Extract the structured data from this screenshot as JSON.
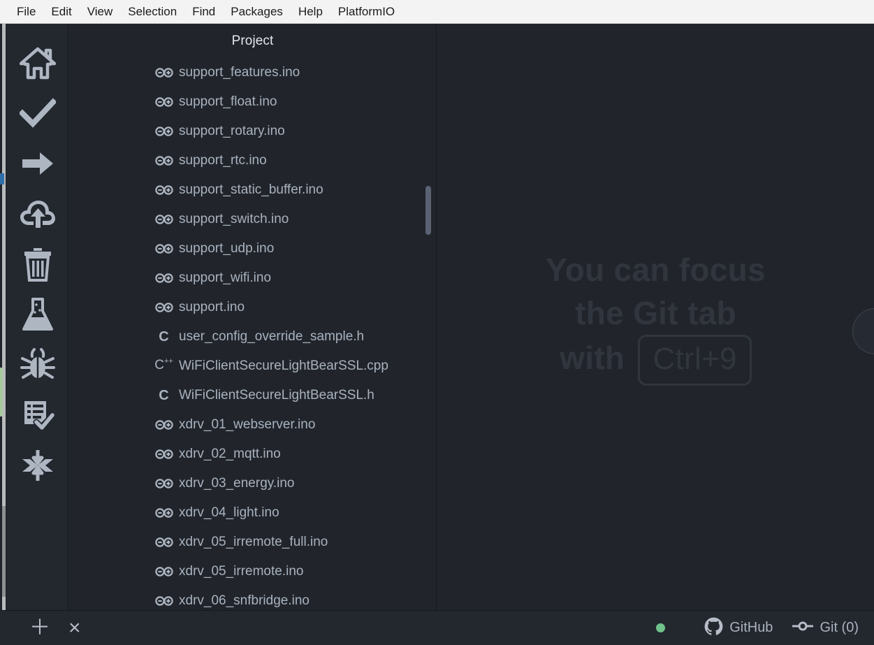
{
  "menubar": {
    "items": [
      {
        "label": "File",
        "name": "menu-file"
      },
      {
        "label": "Edit",
        "name": "menu-edit"
      },
      {
        "label": "View",
        "name": "menu-view"
      },
      {
        "label": "Selection",
        "name": "menu-selection"
      },
      {
        "label": "Find",
        "name": "menu-find"
      },
      {
        "label": "Packages",
        "name": "menu-packages"
      },
      {
        "label": "Help",
        "name": "menu-help"
      },
      {
        "label": "PlatformIO",
        "name": "menu-platformio"
      }
    ]
  },
  "dock": {
    "items": [
      {
        "icon": "home-icon",
        "name": "dock-home"
      },
      {
        "icon": "check-icon",
        "name": "dock-build"
      },
      {
        "icon": "arrow-right-icon",
        "name": "dock-run"
      },
      {
        "icon": "cloud-upload-icon",
        "name": "dock-upload"
      },
      {
        "icon": "trash-icon",
        "name": "dock-clean"
      },
      {
        "icon": "flask-icon",
        "name": "dock-test"
      },
      {
        "icon": "bug-icon",
        "name": "dock-debug"
      },
      {
        "icon": "clipboard-check-icon",
        "name": "dock-report"
      },
      {
        "icon": "collapse-arrows-icon",
        "name": "dock-collapse"
      }
    ]
  },
  "tree": {
    "title": "Project",
    "files": [
      {
        "label": "support_features.ino",
        "icon": "arduino-icon"
      },
      {
        "label": "support_float.ino",
        "icon": "arduino-icon"
      },
      {
        "label": "support_rotary.ino",
        "icon": "arduino-icon"
      },
      {
        "label": "support_rtc.ino",
        "icon": "arduino-icon"
      },
      {
        "label": "support_static_buffer.ino",
        "icon": "arduino-icon"
      },
      {
        "label": "support_switch.ino",
        "icon": "arduino-icon"
      },
      {
        "label": "support_udp.ino",
        "icon": "arduino-icon"
      },
      {
        "label": "support_wifi.ino",
        "icon": "arduino-icon"
      },
      {
        "label": "support.ino",
        "icon": "arduino-icon"
      },
      {
        "label": "user_config_override_sample.h",
        "icon": "c-header-icon"
      },
      {
        "label": "WiFiClientSecureLightBearSSL.cpp",
        "icon": "cpp-icon"
      },
      {
        "label": "WiFiClientSecureLightBearSSL.h",
        "icon": "c-header-icon"
      },
      {
        "label": "xdrv_01_webserver.ino",
        "icon": "arduino-icon"
      },
      {
        "label": "xdrv_02_mqtt.ino",
        "icon": "arduino-icon"
      },
      {
        "label": "xdrv_03_energy.ino",
        "icon": "arduino-icon"
      },
      {
        "label": "xdrv_04_light.ino",
        "icon": "arduino-icon"
      },
      {
        "label": "xdrv_05_irremote_full.ino",
        "icon": "arduino-icon"
      },
      {
        "label": "xdrv_05_irremote.ino",
        "icon": "arduino-icon"
      },
      {
        "label": "xdrv_06_snfbridge.ino",
        "icon": "arduino-icon"
      }
    ]
  },
  "main": {
    "hint_line1": "You can focus",
    "hint_line2": "the Git tab",
    "hint_line3_prefix": "with",
    "hint_shortcut": "Ctrl+9",
    "panel_toggle_glyph": "‹"
  },
  "statusbar": {
    "add_glyph": "＋",
    "close_glyph": "×",
    "github_label": "GitHub",
    "git_label": "Git (0)"
  },
  "colors": {
    "background": "#21252b",
    "dock": "#23272e",
    "menubar": "#f4f3f3",
    "text": "#a9b2bf",
    "hint": "#30353e",
    "status_dot": "#6fc28a",
    "marker_blue": "#2f6ea8",
    "marker_green": "#a8c9a0"
  }
}
